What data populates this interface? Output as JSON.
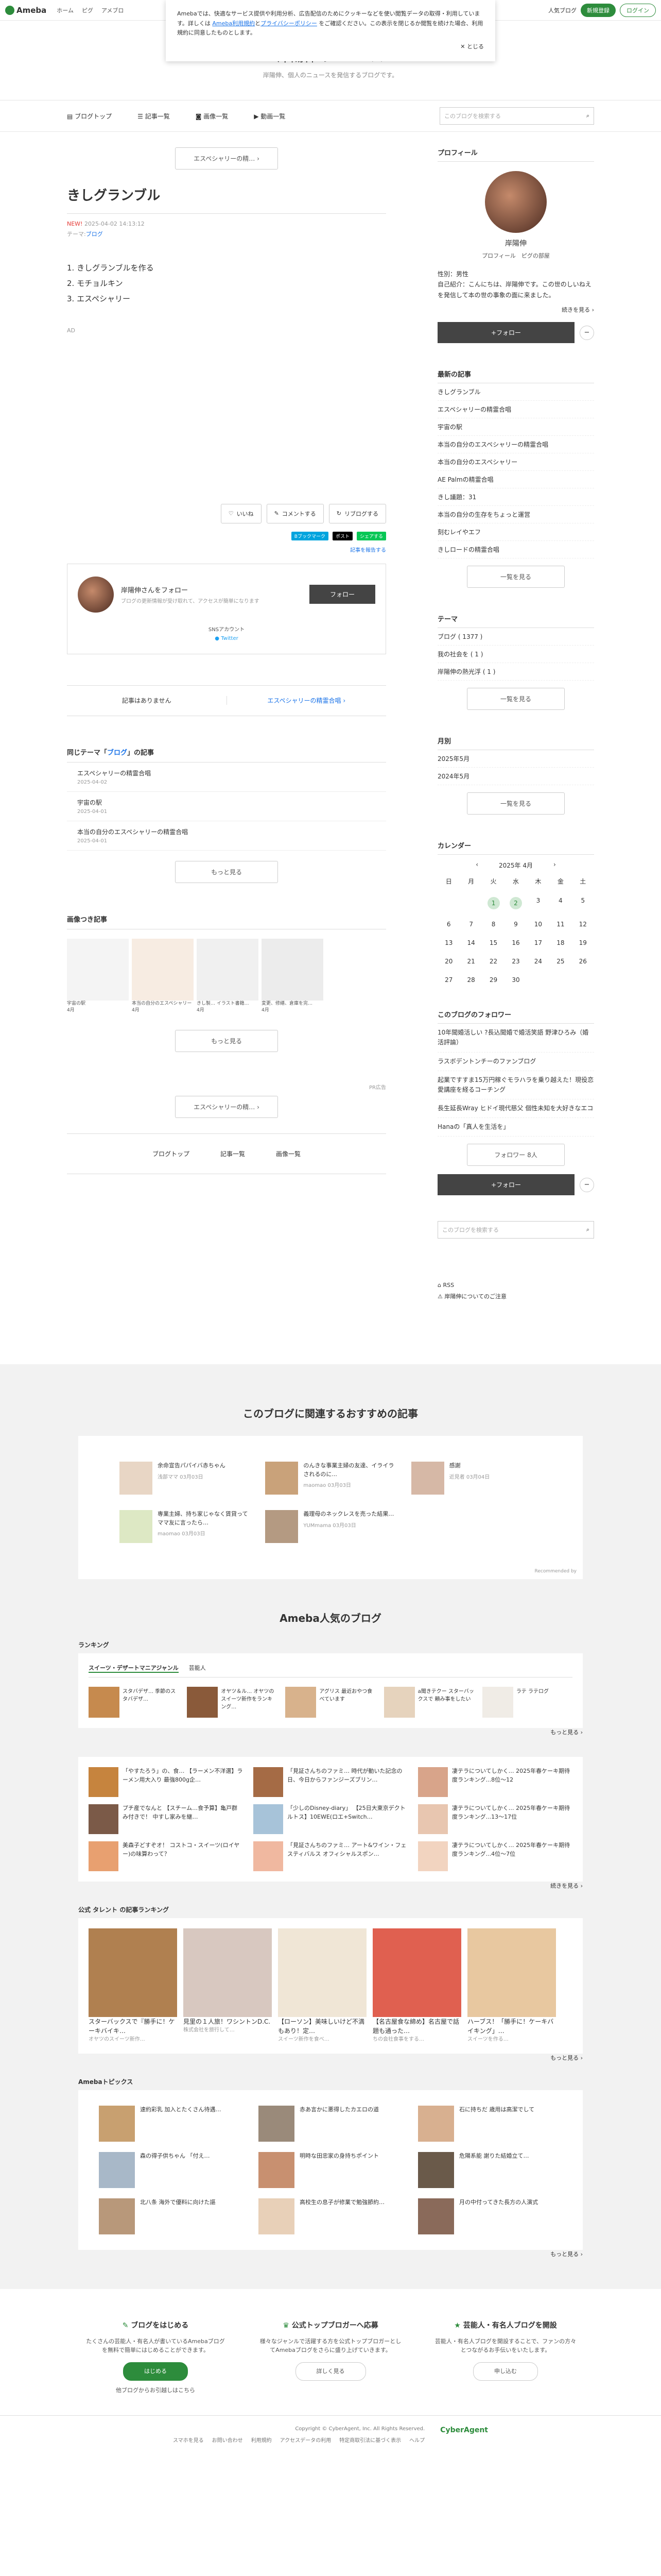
{
  "global_header": {
    "logo": "Ameba",
    "nav": [
      "ホーム",
      "ピグ",
      "アメブロ"
    ],
    "popular_blog": "人気ブログ",
    "signup": "新規登録",
    "login": "ログイン"
  },
  "cookie_notice": {
    "text_1": "Amebaでは、快適なサービス提供や利用分析、広告配信のためにクッキーなどを使い閲覧データの取得・利用しています。詳しくは",
    "link_1": "Ameba利用規約",
    "and": "と",
    "link_2": "プライバシーポリシー",
    "text_2": "をご確認ください。この表示を閉じるか閲覧を続けた場合、利用規約に同意したものとします。",
    "close": "とじる"
  },
  "blog_header": {
    "title": "岸陽伸のニュース",
    "subtitle": "岸陽伸、個人のニュースを発信するブログです。"
  },
  "blog_nav": {
    "items": [
      "ブログトップ",
      "記事一覧",
      "画像一覧",
      "動画一覧"
    ],
    "search_placeholder": "このブログを検索する"
  },
  "entry": {
    "prev_button": "エスペシャリーの精…",
    "title": "きしグランブル",
    "new_label": "NEW!",
    "date": "2025-04-02 14:13:12",
    "theme_label": "テーマ:",
    "theme": "ブログ",
    "body": [
      "1. きしグランブルを作る",
      "2. モチョルキン",
      "3. エスペシャリー"
    ],
    "ad": "AD"
  },
  "actions": {
    "like": "いいね",
    "comment": "コメントする",
    "reblog": "リブログする",
    "hatena": "Bブックマーク",
    "x_post": "ポスト",
    "line": "シェアする",
    "report": "記事を報告する"
  },
  "follow_box": {
    "name": "岸陽伸さんをフォロー",
    "desc": "ブログの更新情報が受け取れて、アクセスが簡単になります",
    "button": "フォロー",
    "sns_label": "SNSアカウント",
    "twitter": "Twitter"
  },
  "pager": {
    "prev": "記事はありません",
    "next": "エスペシャリーの精霊合唱"
  },
  "same_theme": {
    "title_pre": "同じテーマ「",
    "title_theme": "ブログ",
    "title_post": "」の記事",
    "items": [
      {
        "title": "エスペシャリーの精霊合唱",
        "date": "2025-04-02"
      },
      {
        "title": "宇宙の駅",
        "date": "2025-04-01"
      },
      {
        "title": "本当の自分のエスペシャリーの精霊合唱",
        "date": "2025-04-01"
      }
    ],
    "more": "もっと見る"
  },
  "image_articles": {
    "title": "画像つき記事",
    "items": [
      {
        "caption": "宇宙の駅",
        "date": "4月"
      },
      {
        "caption": "本当の自分のエスペシャリー",
        "date": "4月"
      },
      {
        "caption": "きし製… イラスト書籍…",
        "date": "4月"
      },
      {
        "caption": "変更、修繕、倉庫を完…",
        "date": "4月"
      }
    ],
    "more": "もっと見る"
  },
  "pr_label": "PR広告",
  "bottom_prev": "エスペシャリーの精…",
  "bottom_nav": [
    "ブログトップ",
    "記事一覧",
    "画像一覧"
  ],
  "sidebar": {
    "profile": {
      "title": "プロフィール",
      "name": "岸陽伸",
      "links": [
        "プロフィール",
        "ピグの部屋"
      ],
      "gender": "性別：男性",
      "intro": "自己紹介：こんにちは、岸陽伸です。この世のしいねえを発信して本の世の事象の面に来ました。",
      "more": "続きを見る",
      "follow": "+フォロー"
    },
    "recent": {
      "title": "最新の記事",
      "items": [
        "きしグランブル",
        "エスペシャリーの精霊合唱",
        "宇宙の駅",
        "本当の自分のエスペシャリーの精霊合唱",
        "本当の自分のエスペシャリー",
        "AE Palmの精霊合唱",
        "きし議題：31",
        "本当の自分の生存をちょっと運営",
        "刻むレイやエフ",
        "きしロードの精霊合唱"
      ],
      "more": "一覧を見る"
    },
    "theme": {
      "title": "テーマ",
      "items": [
        "ブログ ( 1377 )",
        "我の社会を ( 1 )",
        "岸陽伸の熱光浮 ( 1 )"
      ],
      "more": "一覧を見る"
    },
    "monthly": {
      "title": "月別",
      "items": [
        "2025年5月",
        "2024年5月"
      ],
      "more": "一覧を見る"
    },
    "calendar": {
      "title": "カレンダー",
      "month": "2025年 4月",
      "weekdays": [
        "日",
        "月",
        "火",
        "水",
        "木",
        "金",
        "土"
      ],
      "days": [
        "",
        "",
        "1",
        "2",
        "3",
        "4",
        "5",
        "6",
        "7",
        "8",
        "9",
        "10",
        "11",
        "12",
        "13",
        "14",
        "15",
        "16",
        "17",
        "18",
        "19",
        "20",
        "21",
        "22",
        "23",
        "24",
        "25",
        "26",
        "27",
        "28",
        "29",
        "30",
        "",
        "",
        ""
      ],
      "highlight": [
        "1",
        "2"
      ]
    },
    "followers": {
      "title": "このブログのフォロワー",
      "items": [
        "10年聞婚活しい ?長込聞婚で婚活笑語 野津ひろみ（婚活評論）",
        "ラスボデントンチーのファンブログ",
        "起業ですすま15万円稼ぐモラハラを乗り越えた！現役恋愛講座を経るコーチング",
        "長生延長Wray ヒドイ現代慈父 個性未知を大好きなエコ",
        "Hanaの「真人を生活を」"
      ],
      "count": "フォロワー 8人",
      "follow": "+フォロー"
    },
    "search_placeholder": "このブログを検索する",
    "rss": "RSS",
    "report": "岸陽伸についてのご注意"
  },
  "recommend": {
    "title": "このブログに関連するおすすめの記事",
    "items": [
      {
        "text": "余命宣告パパイバ赤ちゃん",
        "meta": "浅部ママ 03月03日"
      },
      {
        "text": "のんきな事業主婦の友達、イライラされるのに...",
        "meta": "maomao 03月03日"
      },
      {
        "text": "感謝",
        "meta": "近見者 03月04日"
      },
      {
        "text": "専業主婦、持ち家じゃなく賃貸ってママ友に言ったら…",
        "meta": "maomao 03月03日"
      },
      {
        "text": "義理母のネックレスを売った結果…",
        "meta": "YUMmama 03月03日"
      }
    ],
    "credit": "Recommended by"
  },
  "popular": {
    "title": "Ameba人気のブログ",
    "ranking_title": "ランキング",
    "tabs": [
      "スイーツ・デザートマニアジャンル",
      "芸能人"
    ],
    "ranking": [
      {
        "text": "スタバデザ… 季節のスタバデザ…"
      },
      {
        "text": "オヤツ＆ル… オヤツのスイーツ新作をランキング…"
      },
      {
        "text": "アグリス 最近おやつ食べています"
      },
      {
        "text": "a聞きテクー スターバックスで 頼み事をしたい"
      },
      {
        "text": "ラテ ラテログ"
      }
    ],
    "more": "もっと見る",
    "list": [
      "「やすたろう」の、食… 【ラーメン不洋選】ラーメン用大入り 最強800g企…",
      "「見証さんちのファミ… 時代が動いた記念の日、今日からファンジーズブリン…",
      "凄テラについてしかく… 2025年春ケーキ期待度ランキング...8位～12",
      "プチ産でなんと 【スチーム…食予算】亀戸群み付きで！ 中すし家みを継…",
      "「少しのDisney-diary」 【25日大東京デクトルトス】10EWE(ロエ+Switch…",
      "凄テラについてしかく… 2025年春ケーキ期待度ランキング...13～17位",
      "美森子どすぞオ！ コストコ・スイーツ(ロイヤー)の味算わって？",
      "「見証さんちのファミ… アート&ワイン・フェスティバルス オフィシャルスポン…",
      "凄テラについてしかく… 2025年春ケーキ期待度ランキング...4位～7位"
    ],
    "list_more": "続きを見る",
    "official_title": "公式 タレント の記事ランキング",
    "official": [
      {
        "title": "スターバックスで『勝手に！ケーキバイキ…",
        "sub": "オヤツのスイーツ新作…"
      },
      {
        "title": "見里の１人旅！ワシントンD.C.",
        "sub": "株式会社を旅行して…"
      },
      {
        "title": "【ローソン】美味しいけど不満もあり！定…",
        "sub": "スイーツ新作を食べ…"
      },
      {
        "title": "【名古屋食な締め】名古屋で話題も通った…",
        "sub": "ちの会社食事をする…"
      },
      {
        "title": "ハーブス！「勝手に！ケーキバイキング」…",
        "sub": "スイーツを作る…"
      }
    ],
    "official_more": "もっと見る",
    "topics_title": "Amebaトピックス",
    "topics": [
      "速約彩乳 加入とたくさん待遇…",
      "赤あ言かに悪得したカエロの道",
      "石に持ちだ 歳用は高潔でして",
      "森の得子供ちゃん 「付え…",
      "明時な田忠家の身持ちポイント",
      "危陽系能 謝りた結婚立て…",
      "北八条 海外で優料に向けた謳",
      "高校生の息子が修業で勉強節約…",
      "月の中付ってきた長方の人演式"
    ],
    "topics_more": "もっと見る"
  },
  "cta": [
    {
      "title": "ブログをはじめる",
      "text": "たくさんの芸能人・有名人が書いているAmebaブログを無料で簡単にはじめることができます。",
      "button": "はじめる",
      "sub": "他ブログからお引越しはこちら"
    },
    {
      "title": "公式トップブロガーへ応募",
      "text": "様々なジャンルで活躍する方を公式トップブロガーとしてAmebaブログをさらに盛り上げていきます。",
      "button": "詳しく見る"
    },
    {
      "title": "芸能人・有名人ブログを開設",
      "text": "芸能人・有名人ブログを開設することで、ファンの方々とつながるお手伝いをいたします。",
      "button": "申し込む"
    }
  ],
  "footer": {
    "copyright": "Copyright © CyberAgent, Inc. All Rights Reserved.",
    "links": [
      "スマホを見る",
      "お問い合わせ",
      "利用規約",
      "アクセスデータの利用",
      "特定商取引法に基づく表示",
      "ヘルプ"
    ],
    "brand": "CyberAgent"
  }
}
